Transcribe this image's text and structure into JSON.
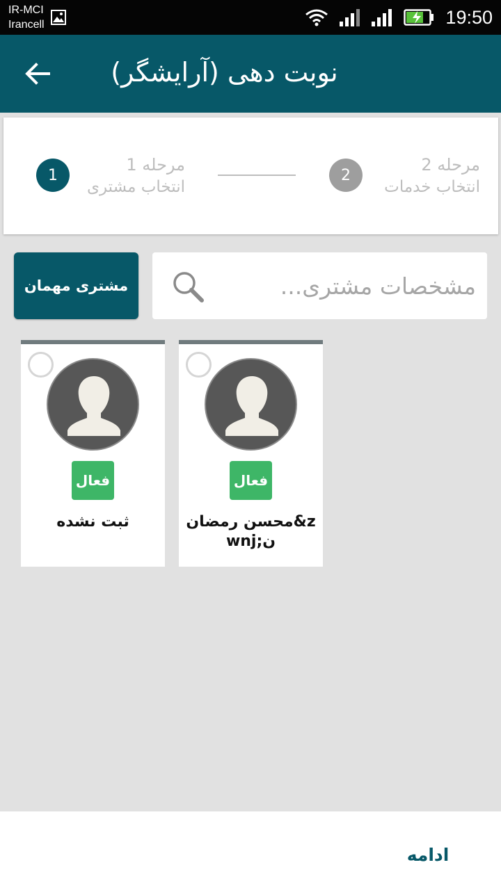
{
  "status_bar": {
    "carrier_line1": "IR-MCI",
    "carrier_line2": "Irancell",
    "time": "19:50",
    "icons": [
      "gallery-icon",
      "wifi-icon",
      "signal-icon",
      "signal-icon",
      "battery-charging-icon"
    ]
  },
  "app_bar": {
    "title": "نوبت دهی (آرایشگر)",
    "back_icon": "arrow-back-icon"
  },
  "stepper": {
    "step1": {
      "number": "1",
      "title": "مرحله 1",
      "subtitle": "انتخاب مشتری",
      "state": "active"
    },
    "step2": {
      "number": "2",
      "title": "مرحله 2",
      "subtitle": "انتخاب خدمات",
      "state": "inactive"
    }
  },
  "search": {
    "placeholder": "مشخصات مشتری...",
    "value": "",
    "icon": "search-icon"
  },
  "guest_button": {
    "label": "مشتری مهمان"
  },
  "customers": [
    {
      "name": "ثبت نشده",
      "status": "فعال",
      "selected": false
    },
    {
      "name": "محسن رمضان&zwnj;ن",
      "status": "فعال",
      "selected": false
    }
  ],
  "footer": {
    "continue_label": "ادامه"
  },
  "colors": {
    "primary": "#075868",
    "status_active": "#3eb667",
    "step_inactive": "#9e9e9e",
    "background": "#e1e1e1"
  }
}
